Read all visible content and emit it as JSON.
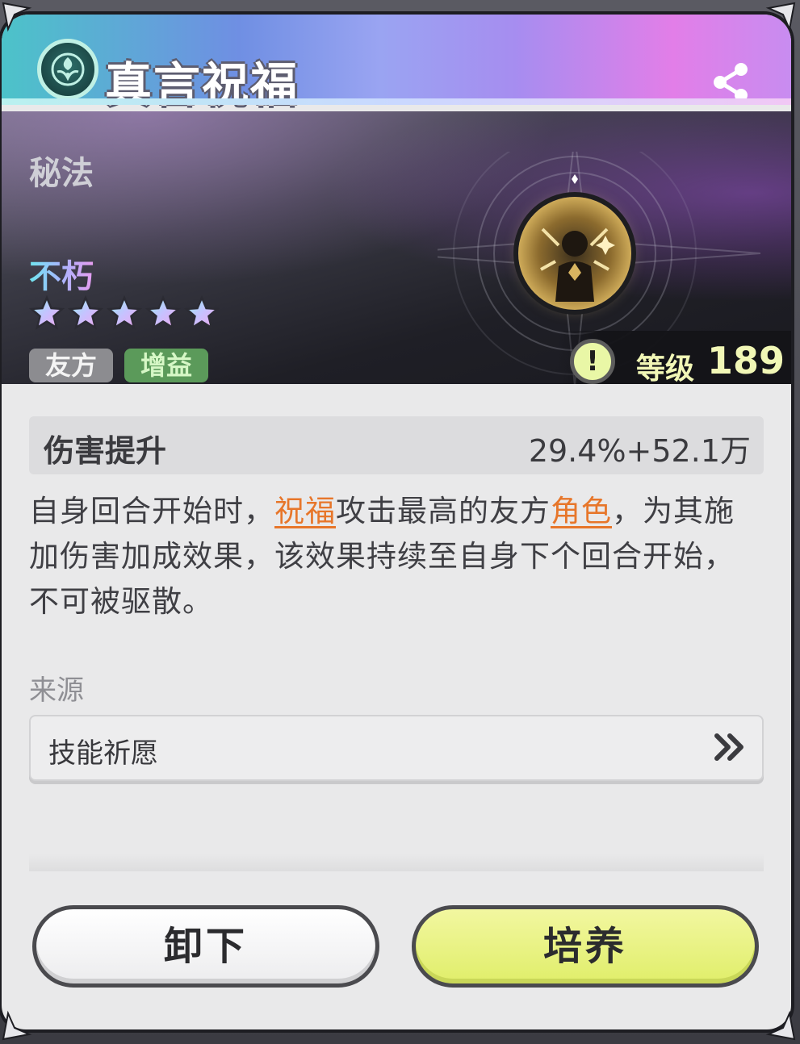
{
  "header": {
    "title": "真言祝福",
    "badge_icon": "teal-emblem-icon",
    "share_icon": "share-icon"
  },
  "banner": {
    "category": "秘法",
    "rarity": "不朽",
    "star_count": 5,
    "tags": [
      "友方",
      "增益"
    ],
    "skill_icon": "praying-figure-icon",
    "level_label": "等级",
    "level_value": "189"
  },
  "stat": {
    "name": "伤害提升",
    "value": "29.4%+52.1万"
  },
  "description": {
    "part1": "自身回合开始时，",
    "kw1": "祝福",
    "part2": "攻击最高的友方",
    "kw2": "角色",
    "part3": "，为其施加伤害加成效果，该效果持续至自身下个回合开始，不可被驱散。"
  },
  "source": {
    "label": "来源",
    "item": "技能祈愿"
  },
  "buttons": {
    "unequip": "卸下",
    "upgrade": "培养"
  },
  "colors": {
    "keyword": "#e7762a",
    "upgrade_button": "#e6f27a",
    "level_text": "#f1f7b6",
    "buff_tag": "#5b9a5a",
    "ally_tag": "#8c8c90"
  }
}
